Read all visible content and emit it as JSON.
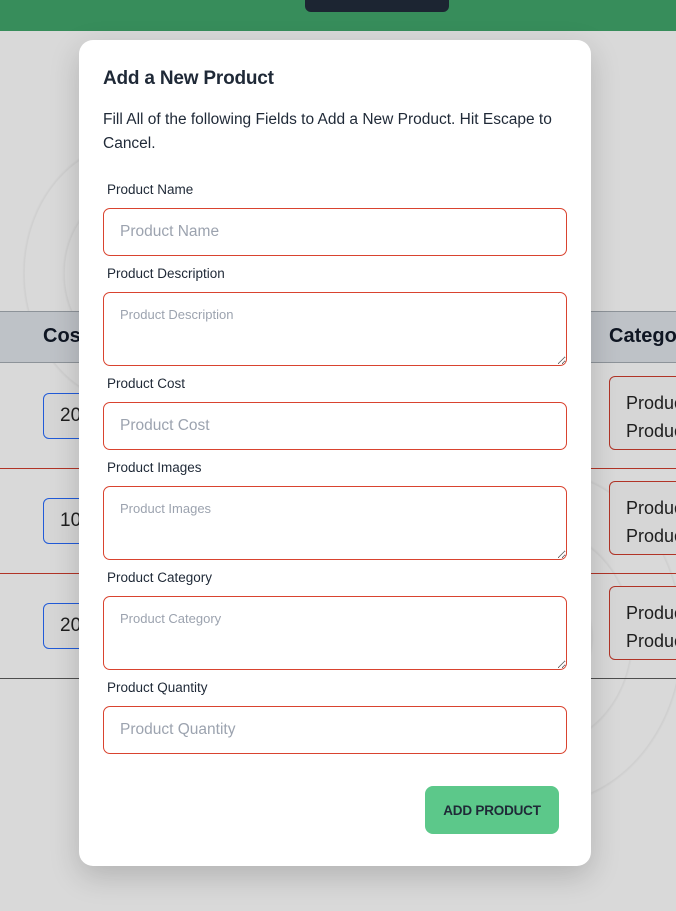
{
  "background": {
    "table": {
      "headers": {
        "cost": "Cost",
        "category": "Categor"
      },
      "rows": [
        {
          "cost": "20",
          "category_line1": "Produc",
          "category_line2": "Produc"
        },
        {
          "cost": "10",
          "category_line1": "Produc",
          "category_line2": "Produc"
        },
        {
          "cost": "20",
          "category_line1": "Produc",
          "category_line2": "Produc"
        }
      ]
    }
  },
  "modal": {
    "title": "Add a New Product",
    "description": "Fill All of the following Fields to Add a New Product. Hit Escape to Cancel.",
    "fields": {
      "name": {
        "label": "Product Name",
        "placeholder": "Product Name"
      },
      "description": {
        "label": "Product Description",
        "placeholder": "Product Description"
      },
      "cost": {
        "label": "Product Cost",
        "placeholder": "Product Cost"
      },
      "images": {
        "label": "Product Images",
        "placeholder": "Product Images"
      },
      "category": {
        "label": "Product Category",
        "placeholder": "Product Category"
      },
      "quantity": {
        "label": "Product Quantity",
        "placeholder": "Product Quantity"
      }
    },
    "submit_label": "ADD PRODUCT"
  },
  "colors": {
    "accent_green": "#5cc88a",
    "topbar_green": "#3c9a63",
    "field_border_error": "#d9432f",
    "cost_border": "#2563eb"
  }
}
